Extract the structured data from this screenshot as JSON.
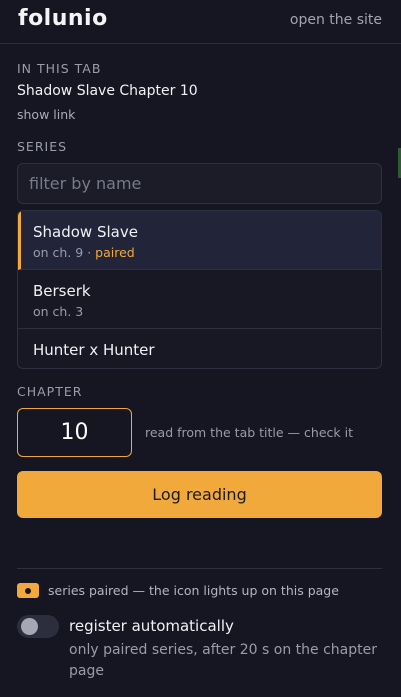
{
  "header": {
    "logo_text": "folunio",
    "open_site_label": "open the site"
  },
  "tab": {
    "section_label": "IN THIS TAB",
    "page_title": "Shadow Slave Chapter 10",
    "show_link_label": "show link"
  },
  "series": {
    "section_label": "SERIES",
    "filter_placeholder": "filter by name",
    "items": [
      {
        "name": "Shadow Slave",
        "progress": "on ch. 9",
        "separator": " · ",
        "paired_label": "paired",
        "selected": true
      },
      {
        "name": "Berserk",
        "progress": "on ch. 3"
      },
      {
        "name": "Hunter x Hunter"
      }
    ]
  },
  "chapter": {
    "section_label": "CHAPTER",
    "value": "10",
    "hint": "read from the tab title — check it"
  },
  "actions": {
    "log_label": "Log reading"
  },
  "footer": {
    "pair_status": "series paired — the icon lights up on this page",
    "auto_register_label": "register automatically",
    "auto_register_hint": "only paired series, after 20 s on the chapter page",
    "auto_register_on": false
  },
  "colors": {
    "accent": "#f2a93b",
    "background": "#151621",
    "panel": "#1b1c28"
  }
}
